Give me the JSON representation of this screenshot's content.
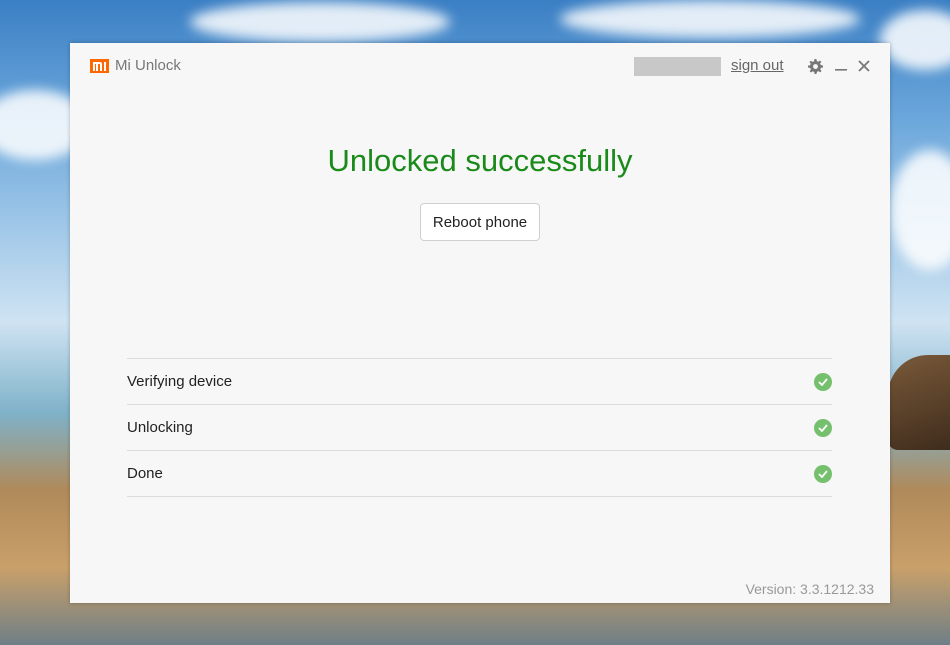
{
  "app": {
    "title": "Mi Unlock",
    "logo_icon": "mi-logo-icon",
    "brand_color": "#ff6700"
  },
  "header": {
    "sign_out": "sign out",
    "icons": [
      "gear-icon",
      "minimize-icon",
      "close-icon"
    ]
  },
  "result": {
    "headline": "Unlocked successfully",
    "headline_color": "#1a8a1a",
    "reboot_button": "Reboot phone"
  },
  "steps": [
    {
      "label": "Verifying device",
      "status": "done"
    },
    {
      "label": "Unlocking",
      "status": "done"
    },
    {
      "label": "Done",
      "status": "done"
    }
  ],
  "check_color": "#74c06d",
  "footer": {
    "version": "Version: 3.3.1212.33"
  }
}
